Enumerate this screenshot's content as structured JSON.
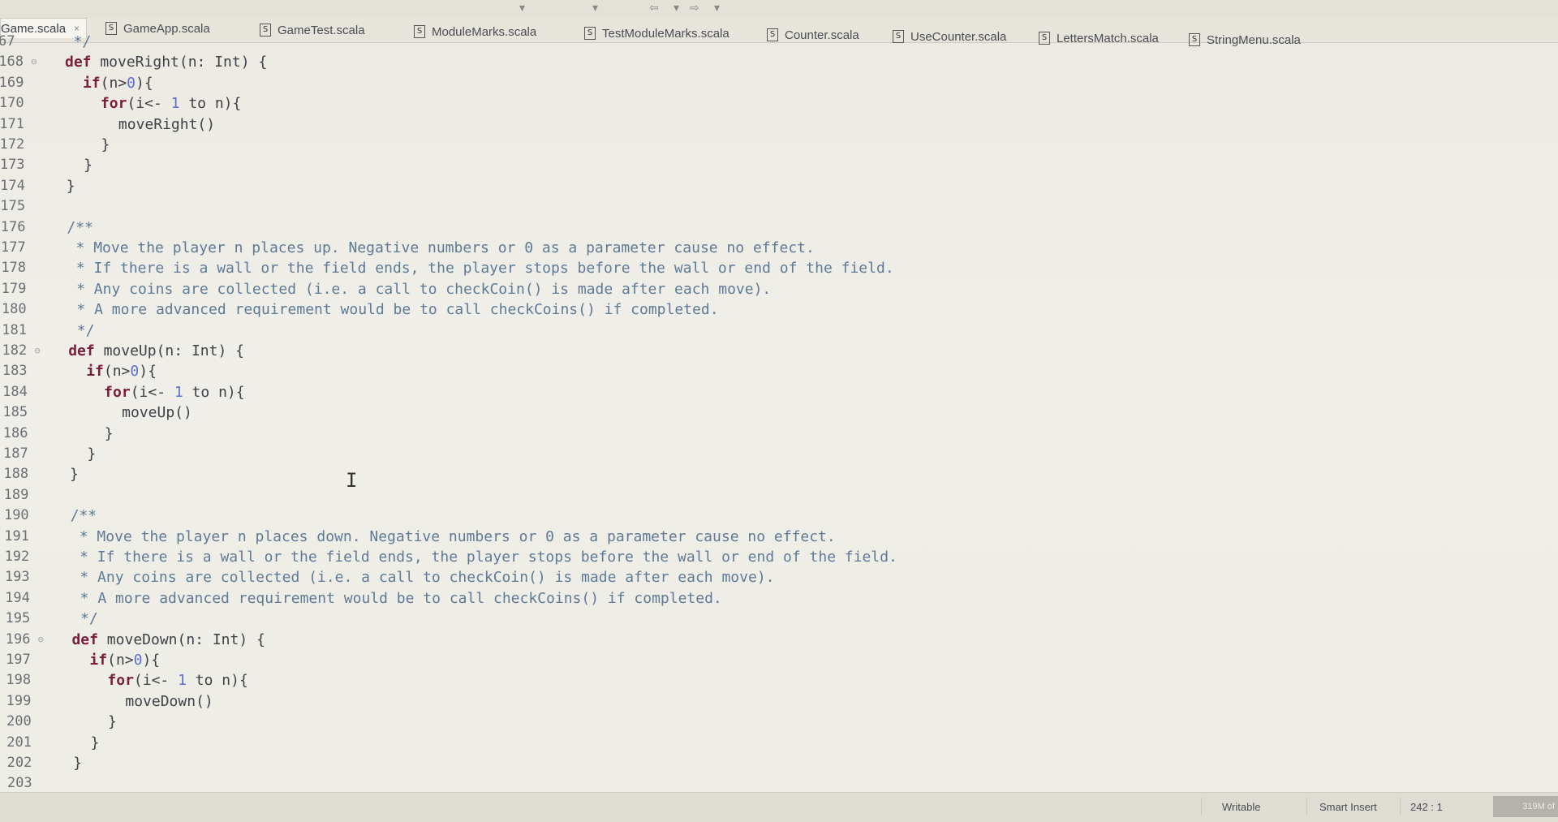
{
  "tabs": [
    {
      "label": "Game.scala",
      "active": true
    },
    {
      "label": "GameApp.scala"
    },
    {
      "label": "GameTest.scala"
    },
    {
      "label": "ModuleMarks.scala"
    },
    {
      "label": "TestModuleMarks.scala"
    },
    {
      "label": "Counter.scala"
    },
    {
      "label": "UseCounter.scala"
    },
    {
      "label": "LettersMatch.scala"
    },
    {
      "label": "StringMenu.scala"
    }
  ],
  "tab_icon_glyph": "S",
  "close_glyph": "×",
  "code_lines": [
    {
      "num": "67",
      "text": "   */"
    },
    {
      "num": "168",
      "text": "  def moveRight(n: Int) {"
    },
    {
      "num": "169",
      "text": "    if(n>0){"
    },
    {
      "num": "170",
      "text": "      for(i<- 1 to n){"
    },
    {
      "num": "171",
      "text": "        moveRight()"
    },
    {
      "num": "172",
      "text": "      }"
    },
    {
      "num": "173",
      "text": "    }"
    },
    {
      "num": "174",
      "text": "  }"
    },
    {
      "num": "175",
      "text": ""
    },
    {
      "num": "176",
      "text": "  /**"
    },
    {
      "num": "177",
      "text": "   * Move the player n places up. Negative numbers or 0 as a parameter cause no effect."
    },
    {
      "num": "178",
      "text": "   * If there is a wall or the field ends, the player stops before the wall or end of the field."
    },
    {
      "num": "179",
      "text": "   * Any coins are collected (i.e. a call to checkCoin() is made after each move)."
    },
    {
      "num": "180",
      "text": "   * A more advanced requirement would be to call checkCoins() if completed."
    },
    {
      "num": "181",
      "text": "   */"
    },
    {
      "num": "182",
      "text": "  def moveUp(n: Int) {"
    },
    {
      "num": "183",
      "text": "    if(n>0){"
    },
    {
      "num": "184",
      "text": "      for(i<- 1 to n){"
    },
    {
      "num": "185",
      "text": "        moveUp()"
    },
    {
      "num": "186",
      "text": "      }"
    },
    {
      "num": "187",
      "text": "    }"
    },
    {
      "num": "188",
      "text": "  }"
    },
    {
      "num": "189",
      "text": ""
    },
    {
      "num": "190",
      "text": "  /**"
    },
    {
      "num": "191",
      "text": "   * Move the player n places down. Negative numbers or 0 as a parameter cause no effect."
    },
    {
      "num": "192",
      "text": "   * If there is a wall or the field ends, the player stops before the wall or end of the field."
    },
    {
      "num": "193",
      "text": "   * Any coins are collected (i.e. a call to checkCoin() is made after each move)."
    },
    {
      "num": "194",
      "text": "   * A more advanced requirement would be to call checkCoins() if completed."
    },
    {
      "num": "195",
      "text": "   */"
    },
    {
      "num": "196",
      "text": "  def moveDown(n: Int) {"
    },
    {
      "num": "197",
      "text": "    if(n>0){"
    },
    {
      "num": "198",
      "text": "      for(i<- 1 to n){"
    },
    {
      "num": "199",
      "text": "        moveDown()"
    },
    {
      "num": "200",
      "text": "      }"
    },
    {
      "num": "201",
      "text": "    }"
    },
    {
      "num": "202",
      "text": "  }"
    },
    {
      "num": "203",
      "text": ""
    }
  ],
  "status": {
    "writable": "Writable",
    "insert_mode": "Smart Insert",
    "position": "242 : 1",
    "heap": "319M of"
  },
  "colors": {
    "keyword": "#7a1e3a",
    "comment": "#5f7a96",
    "number": "#5b6fd0",
    "text": "#3f4148",
    "line_number": "#6c6e74"
  },
  "icons": [
    "scala-file-icon",
    "close-tab-icon",
    "text-cursor-icon",
    "fold-marker-icon"
  ]
}
